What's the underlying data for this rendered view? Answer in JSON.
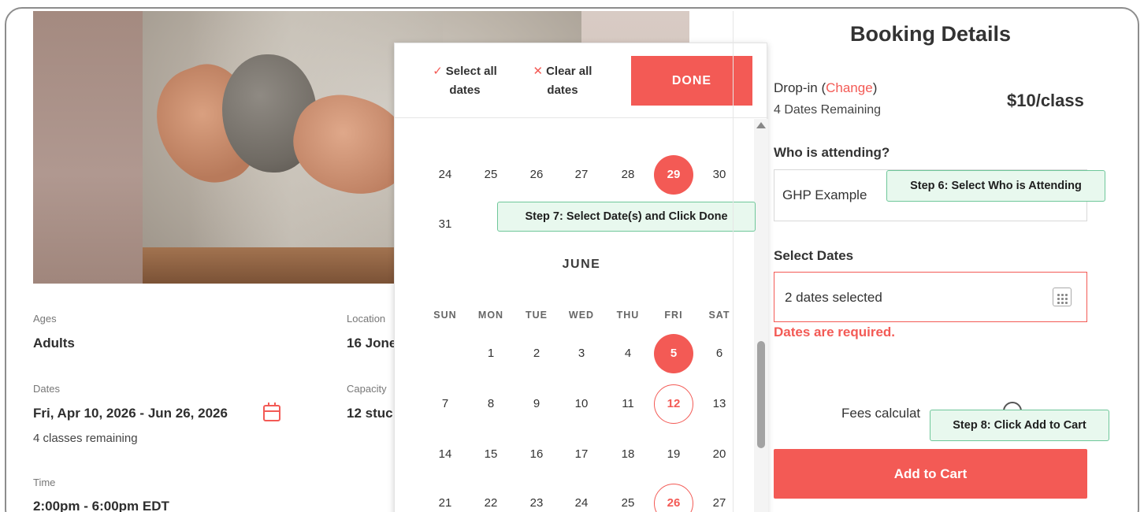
{
  "class_info": {
    "ages_label": "Ages",
    "ages_value": "Adults",
    "location_label": "Location",
    "location_value": "16 Jone",
    "dates_label": "Dates",
    "dates_value": "Fri, Apr 10, 2026 - Jun 26, 2026",
    "classes_remaining": "4 classes remaining",
    "capacity_label": "Capacity",
    "capacity_value": "12 stuc",
    "time_label": "Time",
    "time_value": "2:00pm - 6:00pm EDT"
  },
  "calendar": {
    "select_all_icon": "✓",
    "select_all_label_line1": "Select all",
    "select_all_label_line2": "dates",
    "clear_all_icon": "✕",
    "clear_all_label_line1": "Clear all",
    "clear_all_label_line2": "dates",
    "done_label": "DONE",
    "may_tail": [
      {
        "d": "24",
        "state": "normal"
      },
      {
        "d": "25",
        "state": "normal"
      },
      {
        "d": "26",
        "state": "normal"
      },
      {
        "d": "27",
        "state": "normal"
      },
      {
        "d": "28",
        "state": "normal"
      },
      {
        "d": "29",
        "state": "selected"
      },
      {
        "d": "30",
        "state": "normal"
      },
      {
        "d": "31",
        "state": "normal"
      }
    ],
    "june_title": "JUNE",
    "weekdays": [
      "SUN",
      "MON",
      "TUE",
      "WED",
      "THU",
      "FRI",
      "SAT"
    ],
    "june_rows": [
      [
        null,
        "1",
        "2",
        "3",
        "4",
        "5",
        "6"
      ],
      [
        "7",
        "8",
        "9",
        "10",
        "11",
        "12",
        "13"
      ],
      [
        "14",
        "15",
        "16",
        "17",
        "18",
        "19",
        "20"
      ],
      [
        "21",
        "22",
        "23",
        "24",
        "25",
        "26",
        "27"
      ]
    ],
    "june_selected": [
      "5"
    ],
    "june_available": [
      "12",
      "26"
    ]
  },
  "callouts": {
    "step6": "Step 6: Select Who is Attending",
    "step7": "Step 7: Select Date(s) and Click Done",
    "step8": "Step 8: Click Add to Cart"
  },
  "booking": {
    "title": "Booking Details",
    "plan_prefix": "Drop-in (",
    "change_label": "Change",
    "plan_suffix": ")",
    "dates_remaining": "4 Dates Remaining",
    "price": "$10/class",
    "who_label": "Who is attending?",
    "attendee_value": "GHP Example",
    "select_dates_label": "Select Dates",
    "dates_field_value": "2 dates selected",
    "error_text": "Dates are required.",
    "fees_text": "Fees calculat",
    "add_to_cart_label": "Add to Cart"
  },
  "colors": {
    "accent": "#f35a55",
    "callout_bg": "#e8f8ee",
    "callout_border": "#6fc79a"
  },
  "icons": {
    "date_field": "calendar-grid-icon",
    "dates_info": "calendar-icon",
    "fees_info": "info-circle-icon"
  }
}
